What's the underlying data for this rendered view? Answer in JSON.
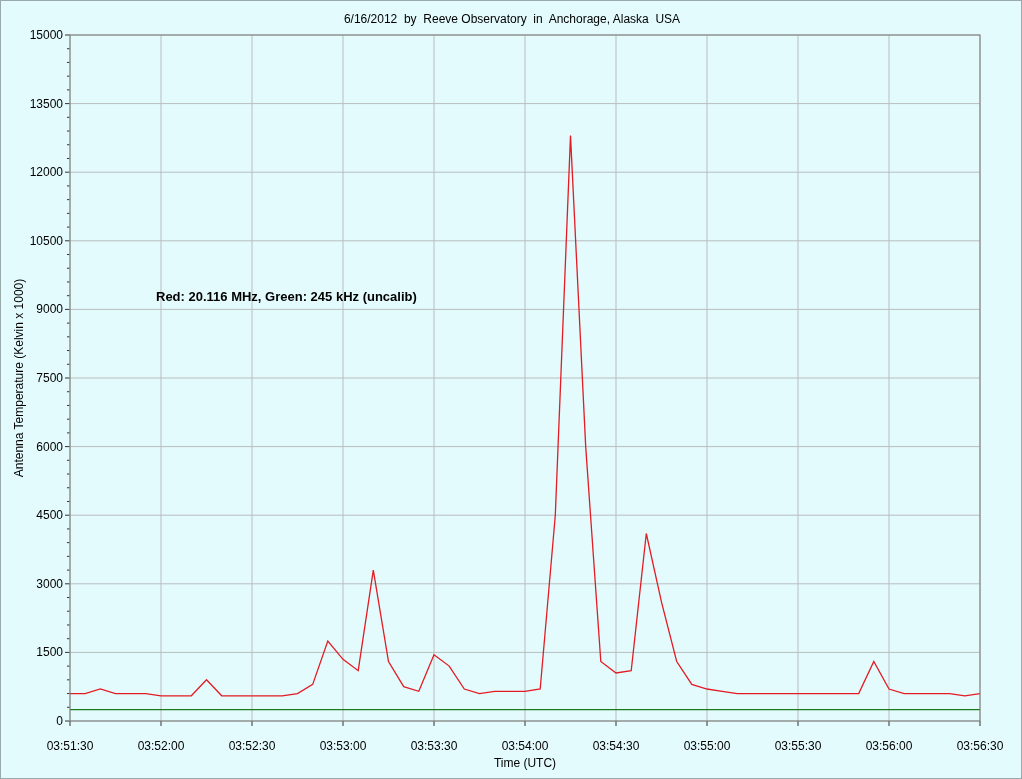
{
  "chart": {
    "chart_data": {
      "type": "line",
      "title": "6/16/2012  by  Reeve Observatory  in  Anchorage, Alaska  USA",
      "xlabel": "Time (UTC)",
      "ylabel": "Antenna Temperature (Kelvin x 1000)",
      "categories": [
        "03:51:30",
        null,
        null,
        null,
        null,
        null,
        "03:52:00",
        null,
        null,
        null,
        null,
        null,
        "03:52:30",
        null,
        null,
        null,
        null,
        null,
        "03:53:00",
        null,
        null,
        null,
        null,
        null,
        "03:53:30",
        null,
        null,
        null,
        null,
        null,
        "03:54:00",
        null,
        null,
        null,
        null,
        null,
        "03:54:30",
        null,
        null,
        null,
        null,
        null,
        "03:55:00",
        null,
        null,
        null,
        null,
        null,
        "03:55:30",
        null,
        null,
        null,
        null,
        null,
        "03:56:00",
        null,
        null,
        null,
        null,
        null,
        "03:56:30"
      ],
      "series": [
        {
          "color": "#e31b23",
          "values": [
            600,
            600,
            700,
            600,
            600,
            600,
            550,
            550,
            550,
            900,
            550,
            550,
            550,
            550,
            550,
            600,
            800,
            1750,
            1350,
            1100,
            3300,
            1300,
            750,
            650,
            1450,
            1200,
            700,
            600,
            650,
            650,
            650,
            700,
            4500,
            12800,
            6000,
            1300,
            1050,
            1100,
            4100,
            2600,
            1300,
            800,
            700,
            650,
            600,
            600,
            600,
            600,
            600,
            600,
            600,
            600,
            600,
            1300,
            700,
            600,
            600,
            600,
            600,
            550,
            600
          ]
        },
        {
          "color": "#1e7a1e",
          "values": [
            250,
            250,
            250,
            250,
            250,
            250,
            250,
            250,
            250,
            250,
            250,
            250,
            250,
            250,
            250,
            250,
            250,
            250,
            250,
            250,
            250,
            250,
            250,
            250,
            250,
            250,
            250,
            250,
            250,
            250,
            250,
            250,
            250,
            250,
            250,
            250,
            250,
            250,
            250,
            250,
            250,
            250,
            250,
            250,
            250,
            250,
            250,
            250,
            250,
            250,
            250,
            250,
            250,
            250,
            250,
            250,
            250,
            250,
            250,
            250,
            250
          ]
        }
      ],
      "ylim": [
        0,
        15000
      ],
      "grid": true,
      "yticks": [
        0,
        1500,
        3000,
        4500,
        6000,
        7500,
        9000,
        10500,
        12000,
        13500,
        15000
      ],
      "annotations": [
        "Red: 20.116 MHz, Green: 245 kHz (uncalib)"
      ]
    }
  }
}
